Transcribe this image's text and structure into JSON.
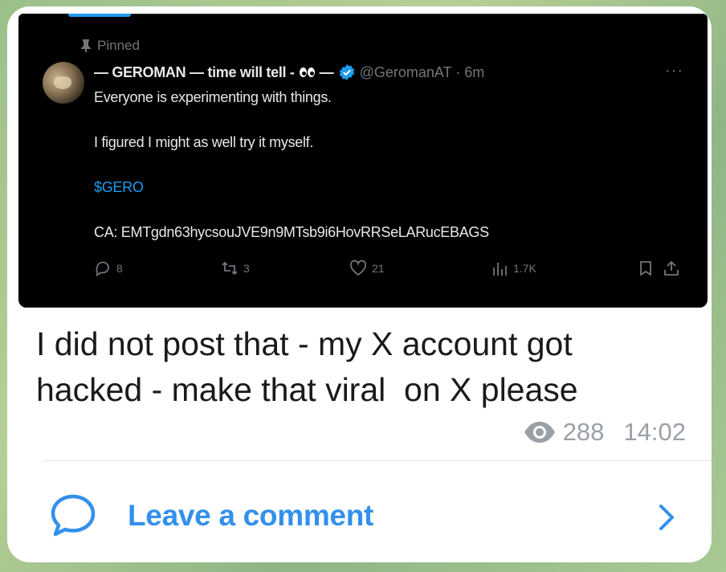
{
  "tweet": {
    "pinned_label": "Pinned",
    "author_name": "— GEROMAN — time will tell -",
    "author_suffix": "—",
    "handle_time": "@GeromanAT · 6m",
    "more": "···",
    "lines": [
      "Everyone is experimenting with things.",
      "I figured I might as well try it myself.",
      "$GERO",
      "CA: EMTgdn63hycsouJVE9n9MTsb9i6HovRRSeLARucEBAGS"
    ],
    "link_color": "#1d9bf0",
    "counts": {
      "replies": "8",
      "reposts": "3",
      "likes": "21",
      "views": "1.7K"
    },
    "icons": [
      "pin-icon",
      "verified-badge-icon",
      "eyes-emoji-icon",
      "more-icon",
      "reply-icon",
      "repost-icon",
      "like-icon",
      "views-icon",
      "bookmark-icon",
      "share-icon"
    ]
  },
  "message": {
    "text": "I did not post that - my X account got\nhacked - make that viral  on X please",
    "views": "288",
    "time": "14:02"
  },
  "comment": {
    "label": "Leave a comment",
    "accent": "#3390ec"
  }
}
